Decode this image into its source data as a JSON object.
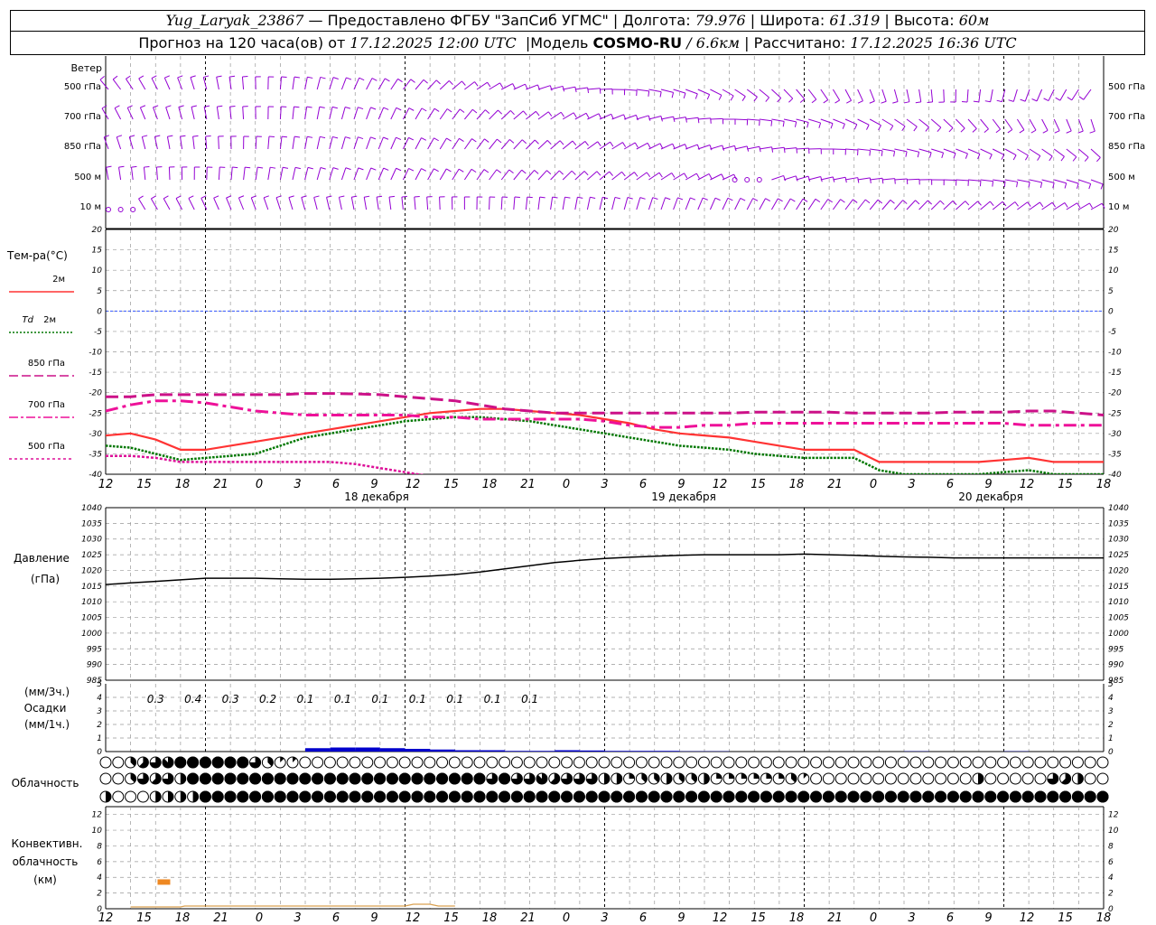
{
  "header": {
    "station": "Yug_Laryak_23867",
    "dash": "—",
    "provider": "Предоставлено ФГБУ \"ЗапСиб УГМС\"",
    "lon_label": "Долгота:",
    "lon_value": "79.976",
    "lat_label": "Широта:",
    "lat_value": "61.319",
    "alt_label": "Высота:",
    "alt_value": "60м",
    "sep": "|",
    "forecast_prefix": "Прогноз на 120 часа(ов) от",
    "forecast_start": "17.12.2025 12:00 UTC",
    "model_label": "Модель",
    "model_name": "COSMO-RU",
    "model_res": "/ 6.6км",
    "computed_label": "Рассчитано:",
    "computed_value": "17.12.2025 16:36 UTC"
  },
  "time_ticks": [
    "12",
    "15",
    "18",
    "21",
    "0",
    "3",
    "6",
    "9",
    "12",
    "15",
    "18",
    "21",
    "0",
    "3",
    "6",
    "9",
    "12",
    "15",
    "18",
    "21",
    "0",
    "3",
    "6",
    "9",
    "12",
    "15",
    "18"
  ],
  "day_labels": [
    {
      "text": "18 декабря",
      "index": 6
    },
    {
      "text": "19 декабря",
      "index": 14
    },
    {
      "text": "20 декабря",
      "index": 22
    }
  ],
  "colors": {
    "wind": "#9400D3",
    "t2m": "#FF3333",
    "td2m": "#007700",
    "t850": "#CC1188",
    "t700": "#EE1199",
    "t500": "#DD1199",
    "pressure": "#000000",
    "precip": "#0000CC",
    "convective": "#EE8822",
    "grid": "#999999",
    "zero_line": "#3355FF"
  },
  "panels": {
    "wind": {
      "title": "Ветер",
      "levels": [
        "500 гПа",
        "700 гПа",
        "850 гПа",
        "500 м",
        "10 м"
      ]
    },
    "temperature": {
      "title": "Тем-ра(°С)",
      "ylim": [
        -40,
        20
      ],
      "ticks": [
        "20",
        "15",
        "10",
        "5",
        "0",
        "-5",
        "-10",
        "-15",
        "-20",
        "-25",
        "-30",
        "-35",
        "-40"
      ],
      "legend": [
        {
          "label": "2м",
          "style": "solid",
          "key": "t2m"
        },
        {
          "label": "2м",
          "prefix": "Td",
          "style": "dotted",
          "key": "td2m"
        },
        {
          "label": "850 гПа",
          "style": "long-dash",
          "key": "t850"
        },
        {
          "label": "700 гПа",
          "style": "dash-dot",
          "key": "t700"
        },
        {
          "label": "500 гПа",
          "style": "short-dash",
          "key": "t500"
        }
      ]
    },
    "pressure": {
      "title": "Давление",
      "unit": "(гПа)",
      "ylim": [
        985,
        1040
      ],
      "ticks": [
        "1040",
        "1035",
        "1030",
        "1025",
        "1020",
        "1015",
        "1010",
        "1005",
        "1000",
        "995",
        "990",
        "985"
      ]
    },
    "precip": {
      "unit3h": "(мм/3ч.)",
      "title": "Осадки",
      "unit1h": "(мм/1ч.)",
      "ylim": [
        0,
        5
      ],
      "ticks": [
        "5",
        "4",
        "3",
        "2",
        "1",
        "0"
      ],
      "labels": [
        "0.3",
        "0.4",
        "0.3",
        "0.2",
        "0.1",
        "0.1",
        "0.1",
        "0.1",
        "0.1",
        "0.1",
        "0.1"
      ]
    },
    "clouds": {
      "title": "Облачность",
      "rows": 3
    },
    "convective": {
      "title_line1": "Конвективн.",
      "title_line2": "облачность",
      "unit": "(км)",
      "ylim": [
        0,
        13
      ],
      "ticks": [
        "12",
        "10",
        "8",
        "6",
        "4",
        "2",
        "0"
      ],
      "top_bar": {
        "hour": 7,
        "top_km": 3.4
      }
    }
  },
  "chart_data": {
    "type": "line",
    "x_hours": [
      0,
      3,
      6,
      9,
      12,
      15,
      18,
      21,
      24,
      27,
      30,
      33,
      36,
      39,
      42,
      45,
      48,
      51,
      54,
      57,
      60,
      63,
      66,
      69,
      72,
      75,
      78,
      81,
      84,
      87,
      90,
      93,
      96,
      99,
      102,
      105,
      108,
      111,
      114,
      117,
      120
    ],
    "series": [
      {
        "name": "2м",
        "key": "t2m",
        "values": [
          -30.5,
          -30,
          -31.5,
          -34,
          -34,
          -33,
          -32,
          -31,
          -30,
          -29,
          -28,
          -27,
          -26,
          -25,
          -24.5,
          -24,
          -24,
          -24.5,
          -25,
          -25.5,
          -26.5,
          -27.5,
          -29,
          -30,
          -30.5,
          -31,
          -32,
          -33,
          -34,
          -34,
          -34,
          -37,
          -37,
          -37,
          -37,
          -37,
          -36.5,
          -36,
          -37,
          -37,
          -37
        ]
      },
      {
        "name": "Td 2м",
        "key": "td2m",
        "values": [
          -33,
          -33.5,
          -35,
          -36.5,
          -36,
          -35.5,
          -35,
          -33,
          -31,
          -30,
          -29,
          -28,
          -27,
          -26.5,
          -26,
          -26,
          -26.5,
          -27,
          -28,
          -29,
          -30,
          -31,
          -32,
          -33,
          -33.5,
          -34,
          -35,
          -35.5,
          -36,
          -36,
          -36,
          -39,
          -40,
          -40,
          -40,
          -40,
          -39.5,
          -39,
          -40,
          -40,
          -40
        ]
      },
      {
        "name": "850 гПа",
        "key": "t850",
        "values": [
          -21,
          -21,
          -20.5,
          -20.5,
          -20.5,
          -20.5,
          -20.5,
          -20.5,
          -20.2,
          -20.2,
          -20.3,
          -20.5,
          -21,
          -21.5,
          -22,
          -23,
          -24,
          -24.5,
          -25,
          -25,
          -25,
          -25,
          -25,
          -25,
          -25,
          -25,
          -24.8,
          -24.8,
          -24.8,
          -24.8,
          -25,
          -25,
          -25,
          -25,
          -24.8,
          -24.8,
          -24.8,
          -24.5,
          -24.5,
          -25,
          -25.5
        ]
      },
      {
        "name": "700 гПа",
        "key": "t700",
        "values": [
          -24.5,
          -23,
          -22,
          -22,
          -22.5,
          -23.5,
          -24.5,
          -25,
          -25.5,
          -25.5,
          -25.5,
          -25.5,
          -25.5,
          -26,
          -26,
          -26.5,
          -26.5,
          -26.5,
          -26.5,
          -26.5,
          -27,
          -28,
          -28.5,
          -28.5,
          -28,
          -28,
          -27.5,
          -27.5,
          -27.5,
          -27.5,
          -27.5,
          -27.5,
          -27.5,
          -27.5,
          -27.5,
          -27.5,
          -27.5,
          -28,
          -28,
          -28,
          -28
        ]
      },
      {
        "name": "500 гПа",
        "key": "t500",
        "values": [
          -35.5,
          -35.5,
          -36,
          -37,
          -37,
          -37,
          -37,
          -37,
          -37,
          -37,
          -37.5,
          -38.5,
          -39.5,
          -40.5,
          -41,
          -41,
          -41,
          -41,
          -41,
          -41,
          -41,
          -41,
          -41,
          -41,
          -41,
          -41,
          -41,
          -41,
          -41,
          -41,
          -41,
          -41,
          -41,
          -41,
          -41,
          -41,
          -41,
          -41,
          -41,
          -41,
          -41
        ]
      },
      {
        "name": "Давление",
        "key": "pressure",
        "values": [
          1015.5,
          1016,
          1016.5,
          1017,
          1017.5,
          1017.5,
          1017.5,
          1017.3,
          1017.2,
          1017.2,
          1017.3,
          1017.5,
          1017.8,
          1018.2,
          1018.7,
          1019.5,
          1020.5,
          1021.5,
          1022.5,
          1023.2,
          1023.8,
          1024.2,
          1024.5,
          1024.8,
          1025,
          1025,
          1025,
          1025,
          1025.2,
          1025,
          1024.8,
          1024.5,
          1024.3,
          1024.2,
          1024,
          1024,
          1024,
          1024,
          1024,
          1024,
          1024
        ]
      },
      {
        "name": "Осадки",
        "key": "precip",
        "values": [
          0,
          0,
          0,
          0,
          0,
          0,
          0,
          0,
          0.25,
          0.3,
          0.3,
          0.25,
          0.2,
          0.15,
          0.1,
          0.1,
          0.05,
          0.05,
          0.1,
          0.08,
          0.05,
          0.05,
          0.05,
          0.02,
          0.02,
          0,
          0,
          0,
          0,
          0,
          0,
          0,
          0.02,
          0,
          0,
          0,
          0.02,
          0,
          0,
          0,
          0
        ]
      }
    ],
    "cloud_cover": {
      "rows": [
        [
          0,
          0,
          3,
          5,
          6,
          7,
          8,
          8,
          8,
          8,
          8,
          8,
          6,
          3,
          1,
          1,
          0,
          0,
          0,
          0,
          0,
          0,
          0,
          0,
          0,
          0,
          0,
          0,
          0,
          0,
          0,
          0,
          0,
          0,
          0,
          0,
          0,
          0,
          0,
          0,
          0,
          0,
          0,
          0,
          0,
          0,
          0,
          0,
          0,
          0,
          0,
          0,
          0,
          0,
          0,
          0,
          0,
          0,
          0,
          0,
          0,
          0,
          0,
          0,
          0,
          0,
          0,
          0,
          0,
          0,
          0,
          0,
          0,
          0,
          0,
          0,
          0,
          0,
          0,
          0,
          0
        ],
        [
          0,
          0,
          3,
          6,
          5,
          6,
          4,
          8,
          8,
          8,
          8,
          8,
          8,
          8,
          8,
          8,
          8,
          8,
          8,
          8,
          8,
          8,
          8,
          8,
          8,
          8,
          8,
          8,
          8,
          8,
          8,
          6,
          8,
          6,
          6,
          7,
          5,
          6,
          6,
          6,
          4,
          4,
          2,
          3,
          3,
          4,
          3,
          3,
          4,
          2,
          2,
          2,
          2,
          2,
          2,
          3,
          1,
          0,
          0,
          0,
          0,
          0,
          0,
          0,
          0,
          0,
          0,
          0,
          0,
          0,
          4,
          0,
          0,
          0,
          0,
          0,
          6,
          5,
          4,
          0,
          0
        ],
        [
          4,
          0,
          0,
          0,
          4,
          4,
          4,
          4,
          8,
          8,
          8,
          8,
          8,
          8,
          8,
          8,
          8,
          8,
          8,
          8,
          8,
          8,
          8,
          8,
          8,
          8,
          8,
          8,
          8,
          8,
          8,
          8,
          8,
          8,
          8,
          8,
          8,
          8,
          8,
          8,
          8,
          8,
          8,
          8,
          8,
          8,
          8,
          8,
          8,
          8,
          8,
          8,
          8,
          8,
          8,
          8,
          8,
          8,
          8,
          8,
          8,
          8,
          8,
          8,
          8,
          8,
          8,
          8,
          8,
          8,
          8,
          8,
          8,
          8,
          8,
          8,
          8,
          8,
          8,
          8,
          8
        ]
      ]
    }
  }
}
